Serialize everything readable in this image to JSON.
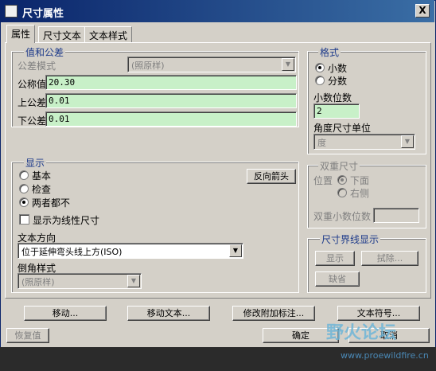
{
  "window": {
    "title": "尺寸属性",
    "close": "X"
  },
  "tabs": [
    {
      "label": "属性"
    },
    {
      "label": "尺寸文本"
    },
    {
      "label": "文本样式"
    }
  ],
  "value_tolerance": {
    "title": "值和公差",
    "tolerance_mode_label": "公差模式",
    "tolerance_mode_value": "(照原样)",
    "nominal_label": "公称值",
    "nominal_value": "20.30",
    "upper_label": "上公差",
    "upper_value": "0.01",
    "lower_label": "下公差",
    "lower_value": "0.01"
  },
  "format": {
    "title": "格式",
    "decimal_label": "小数",
    "fraction_label": "分数",
    "decimal_places_label": "小数位数",
    "decimal_places_value": "2",
    "angular_units_label": "角度尺寸单位",
    "angular_units_value": "度"
  },
  "display": {
    "title": "显示",
    "basic_label": "基本",
    "inspection_label": "检查",
    "neither_label": "两者都不",
    "flip_arrows_label": "反向箭头",
    "show_linear_label": "显示为线性尺寸",
    "text_direction_label": "文本方向",
    "text_direction_value": "位于延伸弯头线上方(ISO)",
    "chamfer_style_label": "倒角样式",
    "chamfer_style_value": "(照原样)"
  },
  "dual_dimension": {
    "title": "双重尺寸",
    "position_label": "位置",
    "below_label": "下面",
    "right_label": "右侧",
    "dual_decimals_label": "双重小数位数",
    "dual_decimals_value": ""
  },
  "witness_line": {
    "title": "尺寸界线显示",
    "show_label": "显示",
    "erase_label": "拭除...",
    "default_label": "缺省"
  },
  "actions": {
    "move": "移动...",
    "move_text": "移动文本...",
    "modify_attach": "修改附加标注...",
    "text_symbol": "文本符号..."
  },
  "footer": {
    "restore": "恢复值",
    "ok": "确定",
    "cancel": "取消"
  },
  "watermark": {
    "text": "野火论坛",
    "url": "www.proewildfire.cn"
  }
}
